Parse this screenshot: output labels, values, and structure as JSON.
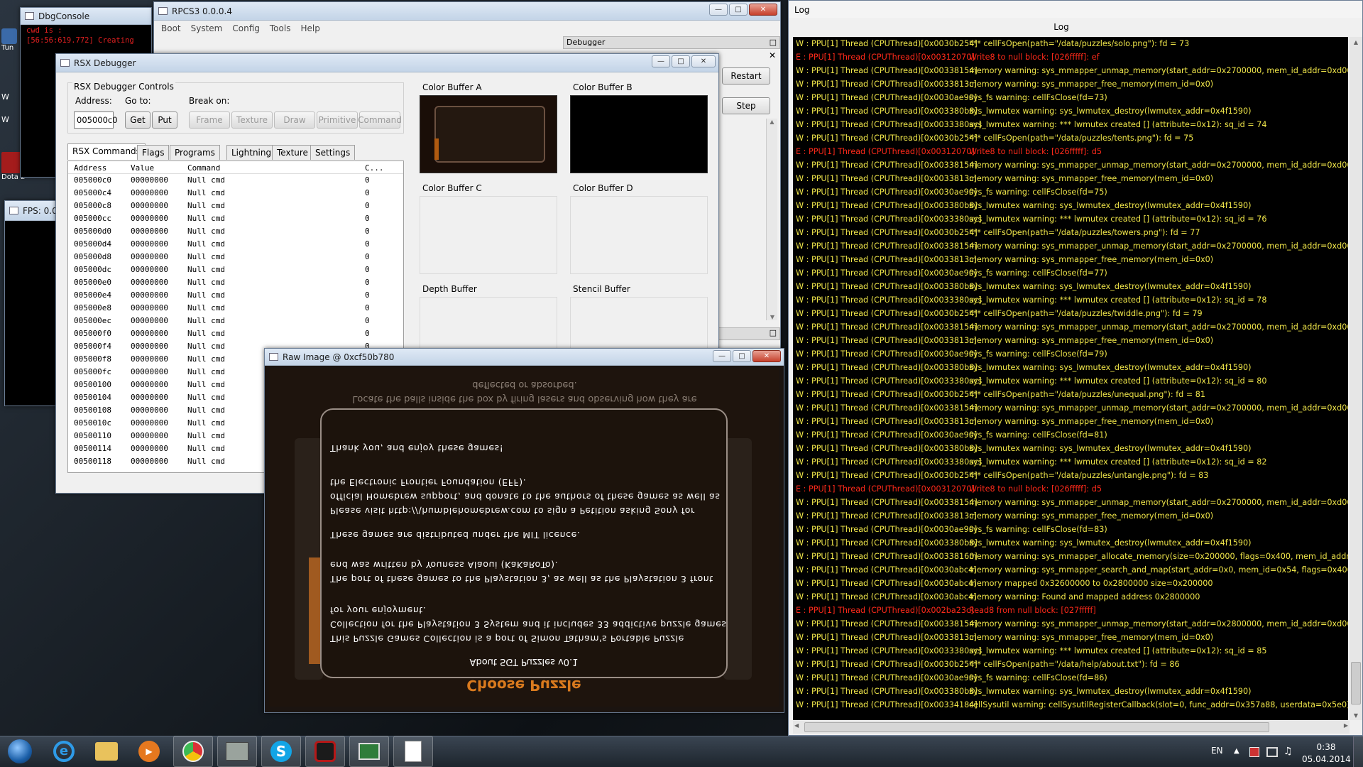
{
  "desktop": {
    "icon_labels": [
      "Tun",
      "W",
      "W",
      "Dota 2"
    ]
  },
  "colors": {
    "log_warning": "#f0e64a",
    "log_error": "#ff2a1a",
    "log_background": "#000000",
    "raw_image_text": "#ffffff",
    "raw_image_title": "#e07b1e"
  },
  "dbgconsole": {
    "title": "DbgConsole",
    "lines": [
      "cwd is :",
      "[56:56:619.772] Creating"
    ]
  },
  "fps_window": {
    "title": "FPS: 0.0"
  },
  "rpcs3": {
    "title": "RPCS3 0.0.0.4",
    "menu": [
      "Boot",
      "System",
      "Config",
      "Tools",
      "Help"
    ],
    "debugger_title": "Debugger",
    "restart_label": "Restart",
    "step_label": "Step"
  },
  "rsx": {
    "title": "RSX Debugger",
    "controls_title": "RSX Debugger Controls",
    "address_label": "Address:",
    "address_value": "005000c0",
    "goto_label": "Go to:",
    "get_label": "Get",
    "put_label": "Put",
    "break_label": "Break on:",
    "break_buttons": [
      "Frame",
      "Texture",
      "Draw",
      "Primitive",
      "Command"
    ],
    "tabs": [
      "RSX Commands",
      "Flags",
      "Programs",
      "Lightning",
      "Texture",
      "Settings"
    ],
    "columns": [
      "Address",
      "Value",
      "Command",
      "C..."
    ],
    "rows": [
      [
        "005000c0",
        "00000000",
        "Null cmd",
        "0"
      ],
      [
        "005000c4",
        "00000000",
        "Null cmd",
        "0"
      ],
      [
        "005000c8",
        "00000000",
        "Null cmd",
        "0"
      ],
      [
        "005000cc",
        "00000000",
        "Null cmd",
        "0"
      ],
      [
        "005000d0",
        "00000000",
        "Null cmd",
        "0"
      ],
      [
        "005000d4",
        "00000000",
        "Null cmd",
        "0"
      ],
      [
        "005000d8",
        "00000000",
        "Null cmd",
        "0"
      ],
      [
        "005000dc",
        "00000000",
        "Null cmd",
        "0"
      ],
      [
        "005000e0",
        "00000000",
        "Null cmd",
        "0"
      ],
      [
        "005000e4",
        "00000000",
        "Null cmd",
        "0"
      ],
      [
        "005000e8",
        "00000000",
        "Null cmd",
        "0"
      ],
      [
        "005000ec",
        "00000000",
        "Null cmd",
        "0"
      ],
      [
        "005000f0",
        "00000000",
        "Null cmd",
        "0"
      ],
      [
        "005000f4",
        "00000000",
        "Null cmd",
        "0"
      ],
      [
        "005000f8",
        "00000000",
        "Null cmd",
        "0"
      ],
      [
        "005000fc",
        "00000000",
        "Null cmd",
        "0"
      ],
      [
        "00500100",
        "00000000",
        "Null cmd",
        "0"
      ],
      [
        "00500104",
        "00000000",
        "Null cmd",
        "0"
      ],
      [
        "00500108",
        "00000000",
        "Null cmd",
        "0"
      ],
      [
        "0050010c",
        "00000000",
        "Null cmd",
        "0"
      ],
      [
        "00500110",
        "00000000",
        "Null cmd",
        "0"
      ],
      [
        "00500114",
        "00000000",
        "Null cmd",
        "0"
      ],
      [
        "00500118",
        "00000000",
        "Null cmd",
        "0"
      ]
    ],
    "buffers": [
      "Color Buffer A",
      "Color Buffer B",
      "Color Buffer C",
      "Color Buffer D",
      "Depth Buffer",
      "Stencil Buffer"
    ]
  },
  "raw_image": {
    "title": "Raw Image @ 0xcf50b780",
    "header_text": "Locate the balls inside the box by firing lasers and observing how they are deflected or absorbed.",
    "dialog_title": "Choose Puzzle",
    "about_title": "About SGT Puzzles v0.1",
    "paragraphs": [
      "This Puzzle Games Collection is a port of Simon Tatham's Portable Puzzle Collection for the Playstation 3 System and it includes 33 addictive puzzle games for your enjoyment.",
      "The port of these games to the Playstation 3, as well as the Playstation 3 front end was written by Youness Alaoui (KaKaRoTo).",
      "These games are distributed under the MIT licence.",
      "Please visit http://\\humblehomebrew.com to sign a Petition asking Sony for official Homebrew support, and donate to the authors of these games as well as the Electronic Frontier Foundation (EFF).",
      "Thank you, and enjoy these games!"
    ]
  },
  "log": {
    "window_title": "Log",
    "header": "Log",
    "lines": [
      {
        "type": "W",
        "thread": "W : PPU[1] Thread (CPUThread)[0x0030b254]",
        "msg": "*** cellFsOpen(path=\"/data/puzzles/solo.png\"): fd = 73"
      },
      {
        "type": "E",
        "thread": "E : PPU[1] Thread (CPUThread)[0x00312070]",
        "msg": "Write8 to null block: [026fffff]: ef"
      },
      {
        "type": "W",
        "thread": "W : PPU[1] Thread (CPUThread)[0x00338154]",
        "msg": "memory warning: sys_mmapper_unmap_memory(start_addr=0x2700000, mem_id_addr=0xd00103d4)"
      },
      {
        "type": "W",
        "thread": "W : PPU[1] Thread (CPUThread)[0x0033813c]",
        "msg": "memory warning: sys_mmapper_free_memory(mem_id=0x0)"
      },
      {
        "type": "W",
        "thread": "W : PPU[1] Thread (CPUThread)[0x0030ae90]",
        "msg": "sys_fs warning: cellFsClose(fd=73)"
      },
      {
        "type": "W",
        "thread": "W : PPU[1] Thread (CPUThread)[0x003380b8]",
        "msg": "sys_lwmutex warning: sys_lwmutex_destroy(lwmutex_addr=0x4f1590)"
      },
      {
        "type": "W",
        "thread": "W : PPU[1] Thread (CPUThread)[0x0033380ac]",
        "msg": "sys_lwmutex warning: *** lwmutex created [] (attribute=0x12): sq_id = 74"
      },
      {
        "type": "W",
        "thread": "W : PPU[1] Thread (CPUThread)[0x0030b254]",
        "msg": "*** cellFsOpen(path=\"/data/puzzles/tents.png\"): fd = 75"
      },
      {
        "type": "E",
        "thread": "E : PPU[1] Thread (CPUThread)[0x00312070]",
        "msg": "Write8 to null block: [026fffff]: d5"
      },
      {
        "type": "W",
        "thread": "W : PPU[1] Thread (CPUThread)[0x00338154]",
        "msg": "memory warning: sys_mmapper_unmap_memory(start_addr=0x2700000, mem_id_addr=0xd00103d4)"
      },
      {
        "type": "W",
        "thread": "W : PPU[1] Thread (CPUThread)[0x0033813c]",
        "msg": "memory warning: sys_mmapper_free_memory(mem_id=0x0)"
      },
      {
        "type": "W",
        "thread": "W : PPU[1] Thread (CPUThread)[0x0030ae90]",
        "msg": "sys_fs warning: cellFsClose(fd=75)"
      },
      {
        "type": "W",
        "thread": "W : PPU[1] Thread (CPUThread)[0x003380b8]",
        "msg": "sys_lwmutex warning: sys_lwmutex_destroy(lwmutex_addr=0x4f1590)"
      },
      {
        "type": "W",
        "thread": "W : PPU[1] Thread (CPUThread)[0x0033380ac]",
        "msg": "sys_lwmutex warning: *** lwmutex created [] (attribute=0x12): sq_id = 76"
      },
      {
        "type": "W",
        "thread": "W : PPU[1] Thread (CPUThread)[0x0030b254]",
        "msg": "*** cellFsOpen(path=\"/data/puzzles/towers.png\"): fd = 77"
      },
      {
        "type": "W",
        "thread": "W : PPU[1] Thread (CPUThread)[0x00338154]",
        "msg": "memory warning: sys_mmapper_unmap_memory(start_addr=0x2700000, mem_id_addr=0xd00103d4)"
      },
      {
        "type": "W",
        "thread": "W : PPU[1] Thread (CPUThread)[0x0033813c]",
        "msg": "memory warning: sys_mmapper_free_memory(mem_id=0x0)"
      },
      {
        "type": "W",
        "thread": "W : PPU[1] Thread (CPUThread)[0x0030ae90]",
        "msg": "sys_fs warning: cellFsClose(fd=77)"
      },
      {
        "type": "W",
        "thread": "W : PPU[1] Thread (CPUThread)[0x003380b8]",
        "msg": "sys_lwmutex warning: sys_lwmutex_destroy(lwmutex_addr=0x4f1590)"
      },
      {
        "type": "W",
        "thread": "W : PPU[1] Thread (CPUThread)[0x0033380ac]",
        "msg": "sys_lwmutex warning: *** lwmutex created [] (attribute=0x12): sq_id = 78"
      },
      {
        "type": "W",
        "thread": "W : PPU[1] Thread (CPUThread)[0x0030b254]",
        "msg": "*** cellFsOpen(path=\"/data/puzzles/twiddle.png\"): fd = 79"
      },
      {
        "type": "W",
        "thread": "W : PPU[1] Thread (CPUThread)[0x00338154]",
        "msg": "memory warning: sys_mmapper_unmap_memory(start_addr=0x2700000, mem_id_addr=0xd000f6e64)"
      },
      {
        "type": "W",
        "thread": "W : PPU[1] Thread (CPUThread)[0x0033813c]",
        "msg": "memory warning: sys_mmapper_free_memory(mem_id=0x0)"
      },
      {
        "type": "W",
        "thread": "W : PPU[1] Thread (CPUThread)[0x0030ae90]",
        "msg": "sys_fs warning: cellFsClose(fd=79)"
      },
      {
        "type": "W",
        "thread": "W : PPU[1] Thread (CPUThread)[0x003380b8]",
        "msg": "sys_lwmutex warning: sys_lwmutex_destroy(lwmutex_addr=0x4f1590)"
      },
      {
        "type": "W",
        "thread": "W : PPU[1] Thread (CPUThread)[0x0033380ac]",
        "msg": "sys_lwmutex warning: *** lwmutex created [] (attribute=0x12): sq_id = 80"
      },
      {
        "type": "W",
        "thread": "W : PPU[1] Thread (CPUThread)[0x0030b254]",
        "msg": "*** cellFsOpen(path=\"/data/puzzles/unequal.png\"): fd = 81"
      },
      {
        "type": "W",
        "thread": "W : PPU[1] Thread (CPUThread)[0x00338154]",
        "msg": "memory warning: sys_mmapper_unmap_memory(start_addr=0x2700000, mem_id_addr=0xd00103d4)"
      },
      {
        "type": "W",
        "thread": "W : PPU[1] Thread (CPUThread)[0x0033813c]",
        "msg": "memory warning: sys_mmapper_free_memory(mem_id=0x0)"
      },
      {
        "type": "W",
        "thread": "W : PPU[1] Thread (CPUThread)[0x0030ae90]",
        "msg": "sys_fs warning: cellFsClose(fd=81)"
      },
      {
        "type": "W",
        "thread": "W : PPU[1] Thread (CPUThread)[0x003380b8]",
        "msg": "sys_lwmutex warning: sys_lwmutex_destroy(lwmutex_addr=0x4f1590)"
      },
      {
        "type": "W",
        "thread": "W : PPU[1] Thread (CPUThread)[0x0033380ac]",
        "msg": "sys_lwmutex warning: *** lwmutex created [] (attribute=0x12): sq_id = 82"
      },
      {
        "type": "W",
        "thread": "W : PPU[1] Thread (CPUThread)[0x0030b254]",
        "msg": "*** cellFsOpen(path=\"/data/puzzles/untangle.png\"): fd = 83"
      },
      {
        "type": "E",
        "thread": "E : PPU[1] Thread (CPUThread)[0x00312070]",
        "msg": "Write8 to null block: [026fffff]: d5"
      },
      {
        "type": "W",
        "thread": "W : PPU[1] Thread (CPUThread)[0x00338154]",
        "msg": "memory warning: sys_mmapper_unmap_memory(start_addr=0x2700000, mem_id_addr=0xd00103d4)"
      },
      {
        "type": "W",
        "thread": "W : PPU[1] Thread (CPUThread)[0x0033813c]",
        "msg": "memory warning: sys_mmapper_free_memory(mem_id=0x0)"
      },
      {
        "type": "W",
        "thread": "W : PPU[1] Thread (CPUThread)[0x0030ae90]",
        "msg": "sys_fs warning: cellFsClose(fd=83)"
      },
      {
        "type": "W",
        "thread": "W : PPU[1] Thread (CPUThread)[0x003380b8]",
        "msg": "sys_lwmutex warning: sys_lwmutex_destroy(lwmutex_addr=0x4f1590)"
      },
      {
        "type": "W",
        "thread": "W : PPU[1] Thread (CPUThread)[0x00338160]",
        "msg": "memory warning: sys_mmapper_allocate_memory(size=0x200000, flags=0x400, mem_id_addr=0xd00"
      },
      {
        "type": "W",
        "thread": "W : PPU[1] Thread (CPUThread)[0x0030abc4]",
        "msg": "memory warning: sys_mmapper_search_and_map(start_addr=0x0, mem_id=0x54, flags=0x40000, allo"
      },
      {
        "type": "W",
        "thread": "W : PPU[1] Thread (CPUThread)[0x0030abc4]",
        "msg": "memory mapped 0x32600000 to 0x2800000 size=0x200000"
      },
      {
        "type": "W",
        "thread": "W : PPU[1] Thread (CPUThread)[0x0030abc4]",
        "msg": "memory warning: Found and mapped address 0x2800000"
      },
      {
        "type": "E",
        "thread": "E : PPU[1] Thread (CPUThread)[0x002ba23c]",
        "msg": "Read8 from null block: [027fffff]"
      },
      {
        "type": "W",
        "thread": "W : PPU[1] Thread (CPUThread)[0x00338154]",
        "msg": "memory warning: sys_mmapper_unmap_memory(start_addr=0x2800000, mem_id_addr=0xd000e6e4)"
      },
      {
        "type": "W",
        "thread": "W : PPU[1] Thread (CPUThread)[0x0033813c]",
        "msg": "memory warning: sys_mmapper_free_memory(mem_id=0x0)"
      },
      {
        "type": "W",
        "thread": "W : PPU[1] Thread (CPUThread)[0x0033380ac]",
        "msg": "sys_lwmutex warning: *** lwmutex created [] (attribute=0x12): sq_id = 85"
      },
      {
        "type": "W",
        "thread": "W : PPU[1] Thread (CPUThread)[0x0030b254]",
        "msg": "*** cellFsOpen(path=\"/data/help/about.txt\"): fd = 86"
      },
      {
        "type": "W",
        "thread": "W : PPU[1] Thread (CPUThread)[0x0030ae90]",
        "msg": "sys_fs warning: cellFsClose(fd=86)"
      },
      {
        "type": "W",
        "thread": "W : PPU[1] Thread (CPUThread)[0x003380b8]",
        "msg": "sys_lwmutex warning: sys_lwmutex_destroy(lwmutex_addr=0x4f1590)"
      },
      {
        "type": "W",
        "thread": "W : PPU[1] Thread (CPUThread)[0x00334184]",
        "msg": "cellSysutil warning: cellSysutilRegisterCallback(slot=0, func_addr=0x357a88, userdata=0x5e0)"
      }
    ]
  },
  "taskbar": {
    "lang": "EN",
    "time": "0:38",
    "date": "05.04.2014",
    "apps": [
      "start-orb",
      "ie-icon",
      "explorer-icon",
      "media-player-icon",
      "chrome-icon",
      "gpu-tool-icon",
      "skype-icon",
      "game-icon",
      "display-icon",
      "notepad-icon"
    ]
  }
}
